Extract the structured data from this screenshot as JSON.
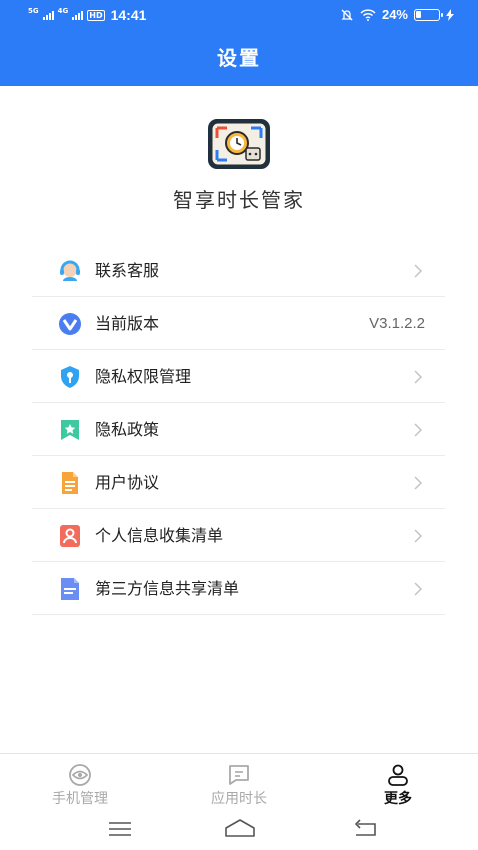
{
  "status_bar": {
    "net1": "5G",
    "net2": "4G",
    "hd": "HD",
    "time": "14:41",
    "battery_pct": "24%",
    "battery_level": 0.24
  },
  "header": {
    "title": "设置"
  },
  "app": {
    "name": "智享时长管家"
  },
  "menu": [
    {
      "label": "联系客服",
      "icon": "customer-service-icon",
      "color": "#3aa8f0"
    },
    {
      "label": "当前版本",
      "icon": "version-icon",
      "color": "#4a7df0",
      "value": "V3.1.2.2"
    },
    {
      "label": "隐私权限管理",
      "icon": "shield-icon",
      "color": "#2fa2f2"
    },
    {
      "label": "隐私政策",
      "icon": "bookmark-star-icon",
      "color": "#3ec9a0"
    },
    {
      "label": "用户协议",
      "icon": "document-icon",
      "color": "#f7a43a"
    },
    {
      "label": "个人信息收集清单",
      "icon": "person-card-icon",
      "color": "#f26b5b"
    },
    {
      "label": "第三方信息共享清单",
      "icon": "list-file-icon",
      "color": "#6b8ef5"
    }
  ],
  "tabs": [
    {
      "label": "手机管理",
      "icon": "eye-icon"
    },
    {
      "label": "应用时长",
      "icon": "message-icon"
    },
    {
      "label": "更多",
      "icon": "user-icon",
      "active": true
    }
  ],
  "colors": {
    "primary": "#2b7cf6",
    "text": "#222222",
    "inactive": "#a9a9a9"
  }
}
